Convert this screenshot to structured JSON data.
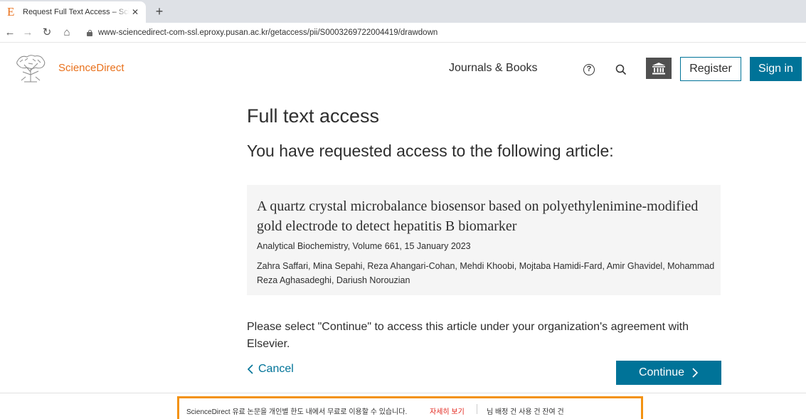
{
  "browser": {
    "tab_title": "Request Full Text Access – ScienceDirect",
    "tab_favicon": "E",
    "url": "www-sciencedirect-com-ssl.eproxy.pusan.ac.kr/getaccess/pii/S0003269722004419/drawdown"
  },
  "header": {
    "brand": "ScienceDirect",
    "nav_journals": "Journals & Books",
    "register": "Register",
    "signin": "Sign in",
    "brand_color": "#e9711c",
    "accent_color": "#007398"
  },
  "main": {
    "title": "Full text access",
    "subtitle": "You have requested access to the following article:",
    "article": {
      "title": "A quartz crystal microbalance biosensor based on polyethylenimine-modified gold electrode to detect hepatitis B biomarker",
      "source": "Analytical Biochemistry, Volume 661, 15 January 2023",
      "authors": "Zahra Saffari, Mina Sepahi, Reza Ahangari-Cohan, Mehdi Khoobi, Mojtaba Hamidi-Fard, Amir Ghavidel, Mohammad Reza Aghasadeghi, Dariush Norouzian"
    },
    "continue_text": "Please select \"Continue\" to access this article under your organization's agreement with Elsevier.",
    "cancel": "Cancel",
    "continue_button": "Continue"
  },
  "notice": {
    "text": "ScienceDirect 유료 논문을 개인별 한도 내에서 무료로 이용할 수 있습니다.",
    "link": "자세히 보기",
    "usage": "님 배정 건  사용 건  잔여 건",
    "border_color": "#f39212"
  }
}
